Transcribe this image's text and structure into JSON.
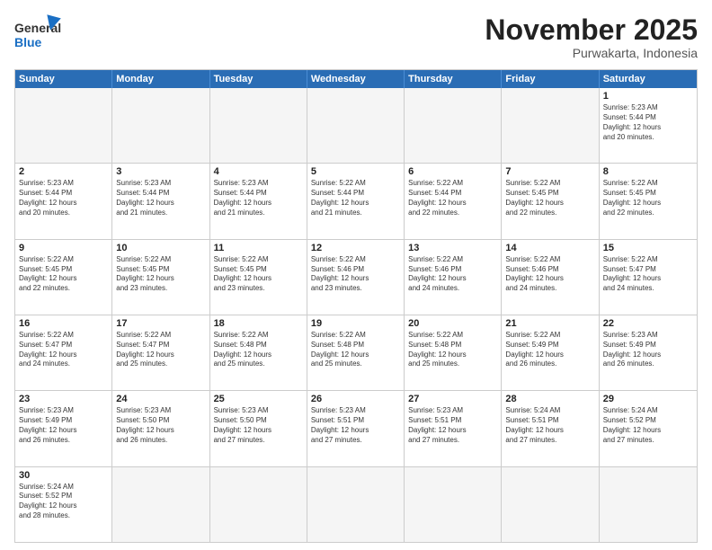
{
  "header": {
    "logo_general": "General",
    "logo_blue": "Blue",
    "month_title": "November 2025",
    "subtitle": "Purwakarta, Indonesia"
  },
  "days_of_week": [
    "Sunday",
    "Monday",
    "Tuesday",
    "Wednesday",
    "Thursday",
    "Friday",
    "Saturday"
  ],
  "rows": [
    [
      {
        "day": "",
        "text": ""
      },
      {
        "day": "",
        "text": ""
      },
      {
        "day": "",
        "text": ""
      },
      {
        "day": "",
        "text": ""
      },
      {
        "day": "",
        "text": ""
      },
      {
        "day": "",
        "text": ""
      },
      {
        "day": "1",
        "text": "Sunrise: 5:23 AM\nSunset: 5:44 PM\nDaylight: 12 hours\nand 20 minutes."
      }
    ],
    [
      {
        "day": "2",
        "text": "Sunrise: 5:23 AM\nSunset: 5:44 PM\nDaylight: 12 hours\nand 20 minutes."
      },
      {
        "day": "3",
        "text": "Sunrise: 5:23 AM\nSunset: 5:44 PM\nDaylight: 12 hours\nand 21 minutes."
      },
      {
        "day": "4",
        "text": "Sunrise: 5:23 AM\nSunset: 5:44 PM\nDaylight: 12 hours\nand 21 minutes."
      },
      {
        "day": "5",
        "text": "Sunrise: 5:22 AM\nSunset: 5:44 PM\nDaylight: 12 hours\nand 21 minutes."
      },
      {
        "day": "6",
        "text": "Sunrise: 5:22 AM\nSunset: 5:44 PM\nDaylight: 12 hours\nand 22 minutes."
      },
      {
        "day": "7",
        "text": "Sunrise: 5:22 AM\nSunset: 5:45 PM\nDaylight: 12 hours\nand 22 minutes."
      },
      {
        "day": "8",
        "text": "Sunrise: 5:22 AM\nSunset: 5:45 PM\nDaylight: 12 hours\nand 22 minutes."
      }
    ],
    [
      {
        "day": "9",
        "text": "Sunrise: 5:22 AM\nSunset: 5:45 PM\nDaylight: 12 hours\nand 22 minutes."
      },
      {
        "day": "10",
        "text": "Sunrise: 5:22 AM\nSunset: 5:45 PM\nDaylight: 12 hours\nand 23 minutes."
      },
      {
        "day": "11",
        "text": "Sunrise: 5:22 AM\nSunset: 5:45 PM\nDaylight: 12 hours\nand 23 minutes."
      },
      {
        "day": "12",
        "text": "Sunrise: 5:22 AM\nSunset: 5:46 PM\nDaylight: 12 hours\nand 23 minutes."
      },
      {
        "day": "13",
        "text": "Sunrise: 5:22 AM\nSunset: 5:46 PM\nDaylight: 12 hours\nand 24 minutes."
      },
      {
        "day": "14",
        "text": "Sunrise: 5:22 AM\nSunset: 5:46 PM\nDaylight: 12 hours\nand 24 minutes."
      },
      {
        "day": "15",
        "text": "Sunrise: 5:22 AM\nSunset: 5:47 PM\nDaylight: 12 hours\nand 24 minutes."
      }
    ],
    [
      {
        "day": "16",
        "text": "Sunrise: 5:22 AM\nSunset: 5:47 PM\nDaylight: 12 hours\nand 24 minutes."
      },
      {
        "day": "17",
        "text": "Sunrise: 5:22 AM\nSunset: 5:47 PM\nDaylight: 12 hours\nand 25 minutes."
      },
      {
        "day": "18",
        "text": "Sunrise: 5:22 AM\nSunset: 5:48 PM\nDaylight: 12 hours\nand 25 minutes."
      },
      {
        "day": "19",
        "text": "Sunrise: 5:22 AM\nSunset: 5:48 PM\nDaylight: 12 hours\nand 25 minutes."
      },
      {
        "day": "20",
        "text": "Sunrise: 5:22 AM\nSunset: 5:48 PM\nDaylight: 12 hours\nand 25 minutes."
      },
      {
        "day": "21",
        "text": "Sunrise: 5:22 AM\nSunset: 5:49 PM\nDaylight: 12 hours\nand 26 minutes."
      },
      {
        "day": "22",
        "text": "Sunrise: 5:23 AM\nSunset: 5:49 PM\nDaylight: 12 hours\nand 26 minutes."
      }
    ],
    [
      {
        "day": "23",
        "text": "Sunrise: 5:23 AM\nSunset: 5:49 PM\nDaylight: 12 hours\nand 26 minutes."
      },
      {
        "day": "24",
        "text": "Sunrise: 5:23 AM\nSunset: 5:50 PM\nDaylight: 12 hours\nand 26 minutes."
      },
      {
        "day": "25",
        "text": "Sunrise: 5:23 AM\nSunset: 5:50 PM\nDaylight: 12 hours\nand 27 minutes."
      },
      {
        "day": "26",
        "text": "Sunrise: 5:23 AM\nSunset: 5:51 PM\nDaylight: 12 hours\nand 27 minutes."
      },
      {
        "day": "27",
        "text": "Sunrise: 5:23 AM\nSunset: 5:51 PM\nDaylight: 12 hours\nand 27 minutes."
      },
      {
        "day": "28",
        "text": "Sunrise: 5:24 AM\nSunset: 5:51 PM\nDaylight: 12 hours\nand 27 minutes."
      },
      {
        "day": "29",
        "text": "Sunrise: 5:24 AM\nSunset: 5:52 PM\nDaylight: 12 hours\nand 27 minutes."
      }
    ],
    [
      {
        "day": "30",
        "text": "Sunrise: 5:24 AM\nSunset: 5:52 PM\nDaylight: 12 hours\nand 28 minutes."
      },
      {
        "day": "",
        "text": ""
      },
      {
        "day": "",
        "text": ""
      },
      {
        "day": "",
        "text": ""
      },
      {
        "day": "",
        "text": ""
      },
      {
        "day": "",
        "text": ""
      },
      {
        "day": "",
        "text": ""
      }
    ]
  ]
}
